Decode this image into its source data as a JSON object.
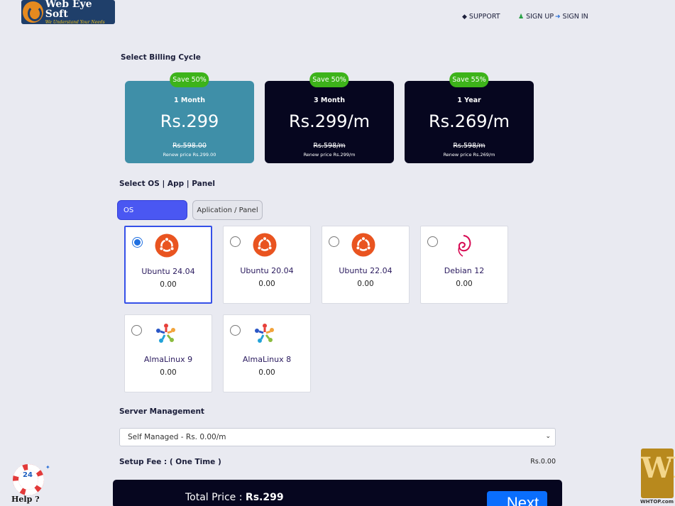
{
  "header": {
    "logo": {
      "title": "Web Eye Soft",
      "tagline": "We Understand Your Needs"
    },
    "nav": [
      {
        "label": "SUPPORT",
        "icon": "ticket-icon"
      },
      {
        "label": "SIGN UP",
        "icon": "user-plus-icon"
      },
      {
        "label": "SIGN IN",
        "icon": "sign-in-icon"
      }
    ]
  },
  "billing": {
    "title": "Select Billing Cycle",
    "cycles": [
      {
        "badge": "Save 50%",
        "period": "1 Month",
        "price": "Rs.299",
        "old_price": "Rs.598.00",
        "renew": "Renew price Rs.299.00",
        "selected": true
      },
      {
        "badge": "Save 50%",
        "period": "3 Month",
        "price": "Rs.299/m",
        "old_price": "Rs.598/m",
        "renew": "Renew price Rs.299/m",
        "selected": false
      },
      {
        "badge": "Save 55%",
        "period": "1 Year",
        "price": "Rs.269/m",
        "old_price": "Rs.598/m",
        "renew": "Renew price Rs.269/m",
        "selected": false
      }
    ]
  },
  "os_section": {
    "title": "Select OS | App | Panel",
    "tabs": [
      {
        "label": "OS",
        "active": true
      },
      {
        "label": "Aplication / Panel",
        "active": false
      }
    ],
    "options": [
      {
        "name": "Ubuntu 24.04",
        "price": "0.00",
        "icon": "ubuntu-icon",
        "selected": true
      },
      {
        "name": "Ubuntu 20.04",
        "price": "0.00",
        "icon": "ubuntu-icon",
        "selected": false
      },
      {
        "name": "Ubuntu 22.04",
        "price": "0.00",
        "icon": "ubuntu-icon",
        "selected": false
      },
      {
        "name": "Debian 12",
        "price": "0.00",
        "icon": "debian-icon",
        "selected": false
      },
      {
        "name": "AlmaLinux 9",
        "price": "0.00",
        "icon": "almalinux-icon",
        "selected": false
      },
      {
        "name": "AlmaLinux 8",
        "price": "0.00",
        "icon": "almalinux-icon",
        "selected": false
      }
    ]
  },
  "management": {
    "title": "Server Management",
    "selected": "Self Managed - Rs. 0.00/m"
  },
  "setup_fee": {
    "label": "Setup Fee : ( One Time )",
    "value": "Rs.0.00"
  },
  "footer": {
    "total_label": "Total Price :",
    "total_value": "Rs.299",
    "next_label": "Next"
  },
  "help": {
    "number": "24",
    "label": "Help ?"
  },
  "watermark": {
    "letters": "WT",
    "site": "WHTOP.com"
  },
  "colors": {
    "active_billing": "#3f8fa8",
    "dark_card": "#06061f",
    "badge_green": "#3db31a",
    "accent_blue": "#4a57f2",
    "button_blue": "#0a6efd"
  }
}
